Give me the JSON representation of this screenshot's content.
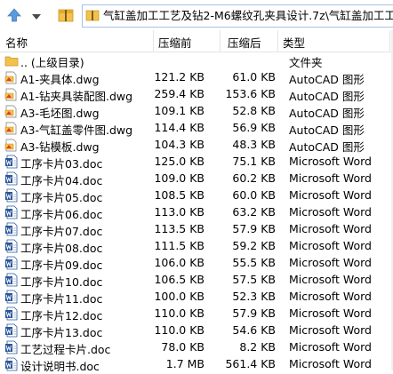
{
  "toolbar": {
    "path": "气缸盖加工工艺及钻2-M6螺纹孔夹具设计.7z\\气缸盖加工工艺"
  },
  "columns": {
    "name": "名称",
    "size": "压缩前",
    "packed": "压缩后",
    "type": "类型"
  },
  "rows": [
    {
      "icon": "folder-up-icon",
      "name": ".. (上级目录)",
      "size": "",
      "packed": "",
      "type": "文件夹"
    },
    {
      "icon": "dwg-file-icon",
      "name": "A1-夹具体.dwg",
      "size": "121.2 KB",
      "packed": "61.0 KB",
      "type": "AutoCAD 图形"
    },
    {
      "icon": "dwg-file-icon",
      "name": "A1-钻夹具装配图.dwg",
      "size": "259.4 KB",
      "packed": "153.6 KB",
      "type": "AutoCAD 图形"
    },
    {
      "icon": "dwg-file-icon",
      "name": "A3-毛坯图.dwg",
      "size": "109.1 KB",
      "packed": "52.8 KB",
      "type": "AutoCAD 图形"
    },
    {
      "icon": "dwg-file-icon",
      "name": "A3-气缸盖零件图.dwg",
      "size": "114.4 KB",
      "packed": "56.9 KB",
      "type": "AutoCAD 图形"
    },
    {
      "icon": "dwg-file-icon",
      "name": "A3-钻模板.dwg",
      "size": "104.3 KB",
      "packed": "48.3 KB",
      "type": "AutoCAD 图形"
    },
    {
      "icon": "word-doc-icon",
      "name": "工序卡片03.doc",
      "size": "125.0 KB",
      "packed": "75.1 KB",
      "type": "Microsoft Word"
    },
    {
      "icon": "word-doc-icon",
      "name": "工序卡片04.doc",
      "size": "109.0 KB",
      "packed": "60.2 KB",
      "type": "Microsoft Word"
    },
    {
      "icon": "word-doc-icon",
      "name": "工序卡片05.doc",
      "size": "108.5 KB",
      "packed": "60.0 KB",
      "type": "Microsoft Word"
    },
    {
      "icon": "word-doc-icon",
      "name": "工序卡片06.doc",
      "size": "113.0 KB",
      "packed": "63.2 KB",
      "type": "Microsoft Word"
    },
    {
      "icon": "word-doc-icon",
      "name": "工序卡片07.doc",
      "size": "113.5 KB",
      "packed": "57.9 KB",
      "type": "Microsoft Word"
    },
    {
      "icon": "word-doc-icon",
      "name": "工序卡片08.doc",
      "size": "111.5 KB",
      "packed": "59.2 KB",
      "type": "Microsoft Word"
    },
    {
      "icon": "word-doc-icon",
      "name": "工序卡片09.doc",
      "size": "106.0 KB",
      "packed": "55.5 KB",
      "type": "Microsoft Word"
    },
    {
      "icon": "word-doc-icon",
      "name": "工序卡片10.doc",
      "size": "106.5 KB",
      "packed": "57.5 KB",
      "type": "Microsoft Word"
    },
    {
      "icon": "word-doc-icon",
      "name": "工序卡片11.doc",
      "size": "100.0 KB",
      "packed": "52.3 KB",
      "type": "Microsoft Word"
    },
    {
      "icon": "word-doc-icon",
      "name": "工序卡片12.doc",
      "size": "110.0 KB",
      "packed": "57.9 KB",
      "type": "Microsoft Word"
    },
    {
      "icon": "word-doc-icon",
      "name": "工序卡片13.doc",
      "size": "110.0 KB",
      "packed": "54.6 KB",
      "type": "Microsoft Word"
    },
    {
      "icon": "word-doc-icon",
      "name": "工艺过程卡片.doc",
      "size": "78.0 KB",
      "packed": "8.2 KB",
      "type": "Microsoft Word"
    },
    {
      "icon": "word-doc-icon",
      "name": "设计说明书.doc",
      "size": "1.7 MB",
      "packed": "561.4 KB",
      "type": "Microsoft Word"
    }
  ]
}
